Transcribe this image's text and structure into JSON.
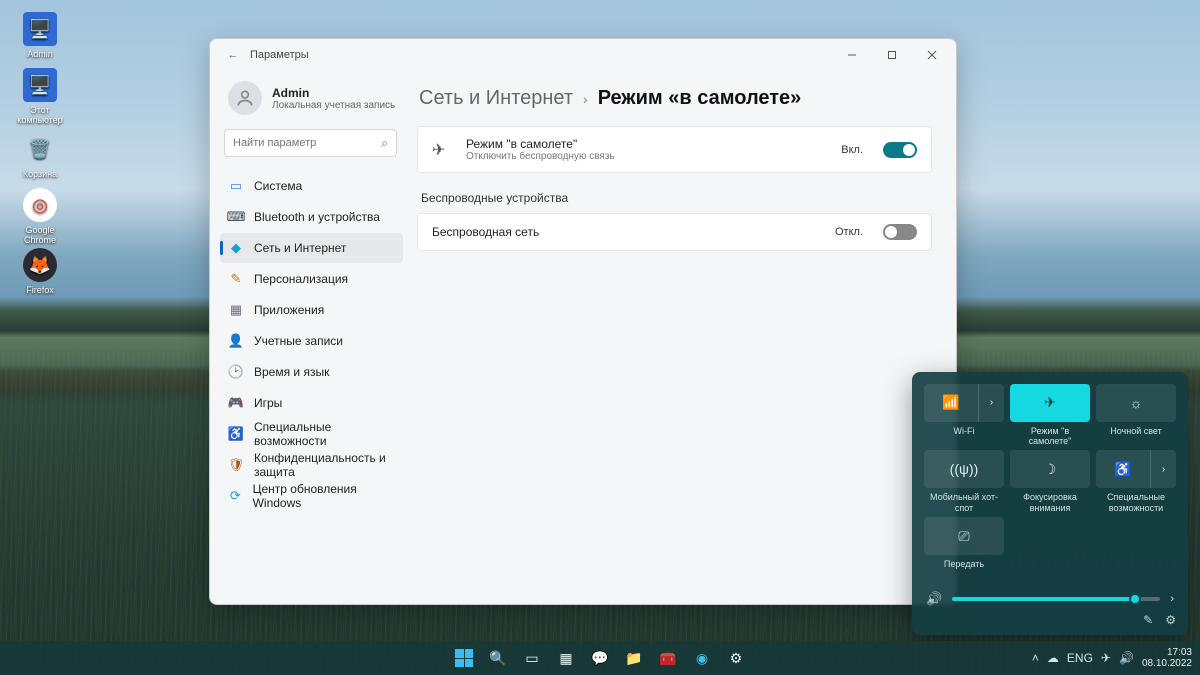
{
  "desktop_icons": [
    {
      "label": "Admin",
      "glyph": "🖥️",
      "bg": "#2e6ad1"
    },
    {
      "label": "Этот компьютер",
      "glyph": "🖥️",
      "bg": "#2e6ad1"
    },
    {
      "label": "Корзина",
      "glyph": "🗑️",
      "bg": "transparent"
    },
    {
      "label": "Google Chrome",
      "glyph": "◎",
      "bg": "#fff"
    },
    {
      "label": "Firefox",
      "glyph": "🦊",
      "bg": "#2b2a33"
    }
  ],
  "settings": {
    "title": "Параметры",
    "user": {
      "name": "Admin",
      "sub": "Локальная учетная запись"
    },
    "search_placeholder": "Найти параметр",
    "nav": [
      {
        "l": "Система",
        "c": "#3b82f6",
        "g": "▭"
      },
      {
        "l": "Bluetooth и устройства",
        "c": "#374151",
        "g": "⌨"
      },
      {
        "l": "Сеть и Интернет",
        "c": "#18a0c9",
        "g": "◆",
        "sel": true
      },
      {
        "l": "Персонализация",
        "c": "#d97706",
        "g": "✎"
      },
      {
        "l": "Приложения",
        "c": "#6b7280",
        "g": "▦"
      },
      {
        "l": "Учетные записи",
        "c": "#7c3aed",
        "g": "👤"
      },
      {
        "l": "Время и язык",
        "c": "#0ea5a0",
        "g": "🕑"
      },
      {
        "l": "Игры",
        "c": "#16a34a",
        "g": "🎮"
      },
      {
        "l": "Специальные возможности",
        "c": "#0891b2",
        "g": "♿"
      },
      {
        "l": "Конфиденциальность и защита",
        "c": "#b45309",
        "g": "🛡"
      },
      {
        "l": "Центр обновления Windows",
        "c": "#0ea5e9",
        "g": "⟳"
      }
    ],
    "breadcrumb": {
      "a": "Сеть и Интернет",
      "b": "Режим «в самолете»"
    },
    "airplane": {
      "glyph": "✈",
      "title": "Режим \"в самолете\"",
      "sub": "Отключить беспроводную связь",
      "state": "Вкл."
    },
    "section": "Беспроводные устройства",
    "wifi": {
      "title": "Беспроводная сеть",
      "state": "Откл."
    }
  },
  "quick": {
    "tiles": [
      {
        "g": "📶",
        "label": "Wi-Fi",
        "split": true
      },
      {
        "g": "✈",
        "label": "Режим \"в самолете\"",
        "on": true
      },
      {
        "g": "☼",
        "label": "Ночной свет"
      },
      {
        "g": "((ψ))",
        "label": "Мобильный хот-спот"
      },
      {
        "g": "☽",
        "label": "Фокусировка внимания"
      },
      {
        "g": "♿",
        "label": "Специальные возможности",
        "split": true
      }
    ],
    "cast": {
      "g": "⎚",
      "label": "Передать"
    }
  },
  "tray": {
    "lang": "ENG",
    "time": "17:03",
    "date": "08.10.2022"
  }
}
